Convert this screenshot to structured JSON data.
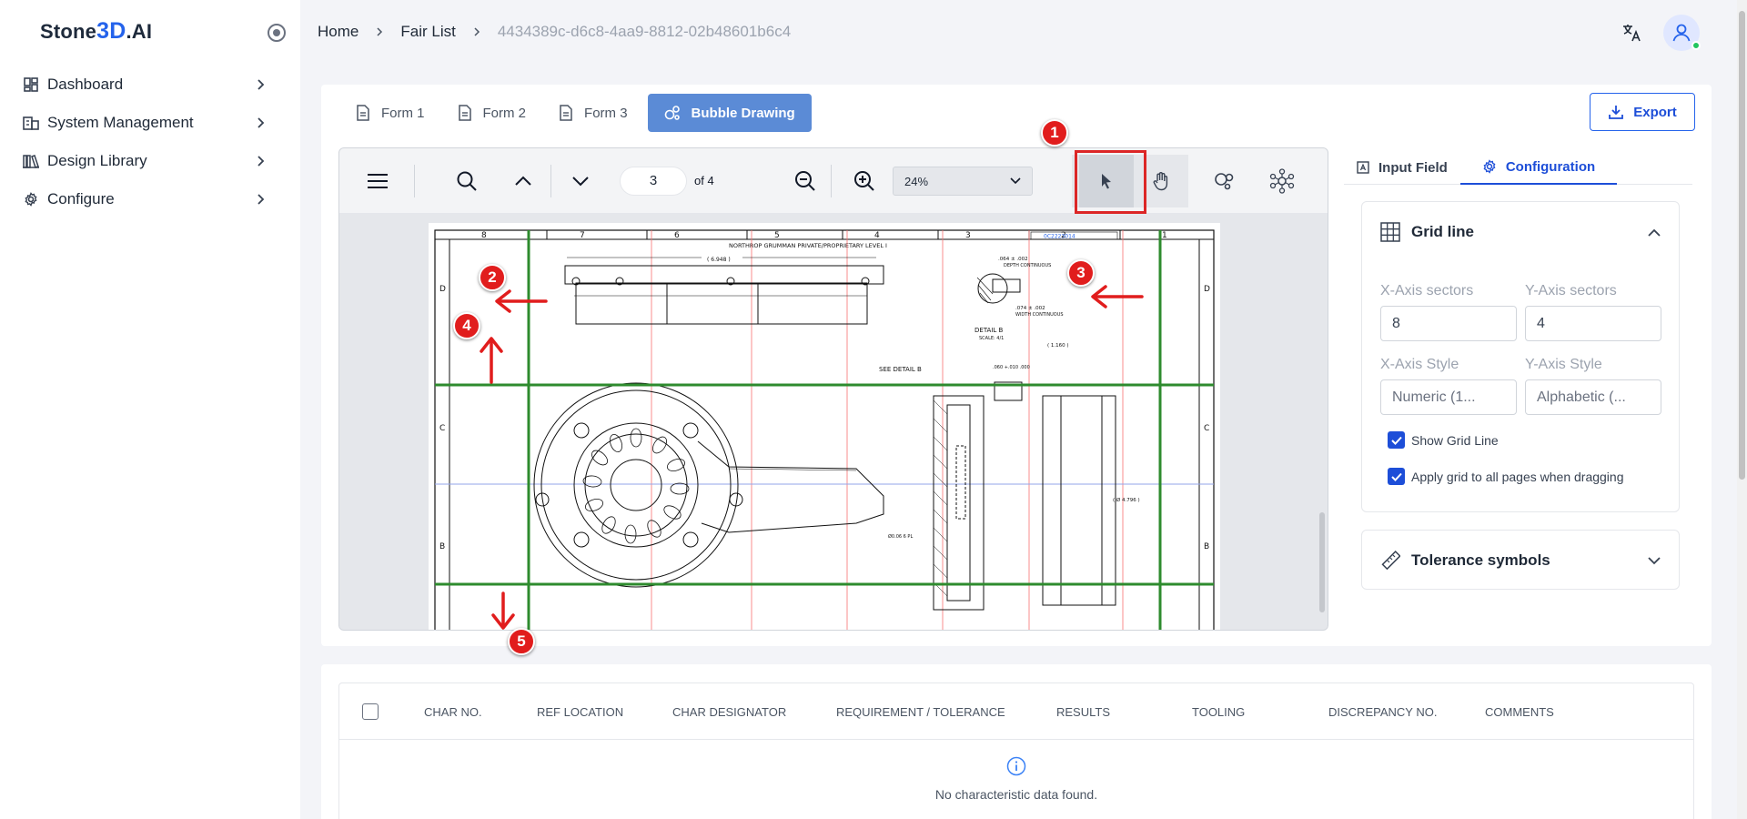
{
  "app": {
    "logo_prefix": "Stone",
    "logo_accent": "3D",
    "logo_suffix": ".AI"
  },
  "sidebar": {
    "items": [
      {
        "label": "Dashboard",
        "icon": "dashboard-icon"
      },
      {
        "label": "System Management",
        "icon": "building-icon"
      },
      {
        "label": "Design Library",
        "icon": "library-icon"
      },
      {
        "label": "Configure",
        "icon": "gear-icon"
      }
    ]
  },
  "breadcrumb": {
    "items": [
      "Home",
      "Fair List"
    ],
    "current": "4434389c-d6c8-4aa9-8812-02b48601b6c4"
  },
  "tabs": [
    {
      "label": "Form 1",
      "active": false
    },
    {
      "label": "Form 2",
      "active": false
    },
    {
      "label": "Form 3",
      "active": false
    },
    {
      "label": "Bubble Drawing",
      "active": true
    }
  ],
  "export_label": "Export",
  "viewer": {
    "page_current": "3",
    "page_total_label": "of 4",
    "zoom": "24%",
    "selected_tool": "select-pointer"
  },
  "drawing": {
    "header_text": "NORTHROP GRUMMAN PRIVATE/PROPRIETARY LEVEL I",
    "drawing_number": "0C2223014",
    "detail_label": "DETAIL B",
    "scale_label": "SCALE: 4/1",
    "see_detail": "SEE DETAIL B",
    "col_labels": [
      "8",
      "7",
      "6",
      "5",
      "4",
      "3",
      "2",
      "1"
    ],
    "row_labels": [
      "D",
      "C",
      "B"
    ],
    "dims": [
      "( 6.948 )",
      ".064 ± .002",
      "DEPTH CONTINUOUS",
      ".074 ± .002",
      "WIDTH CONTINUOUS",
      "( 1.160 )",
      ".060 +.010 .000",
      "( Ø 4.796 )",
      "Ø0.06 6 PL"
    ]
  },
  "annotations": [
    {
      "number": "1"
    },
    {
      "number": "2"
    },
    {
      "number": "3"
    },
    {
      "number": "4"
    },
    {
      "number": "5"
    }
  ],
  "right_panel": {
    "tabs": [
      {
        "label": "Input Field",
        "active": false
      },
      {
        "label": "Configuration",
        "active": true
      }
    ],
    "grid_line": {
      "title": "Grid line",
      "x_sectors_label": "X-Axis sectors",
      "y_sectors_label": "Y-Axis sectors",
      "x_sectors_value": "8",
      "y_sectors_value": "4",
      "x_style_label": "X-Axis Style",
      "y_style_label": "Y-Axis Style",
      "x_style_value": "Numeric (1...",
      "y_style_value": "Alphabetic (...",
      "show_grid_label": "Show Grid Line",
      "show_grid_checked": true,
      "apply_all_label": "Apply grid to all pages when dragging",
      "apply_all_checked": true
    },
    "tolerance": {
      "title": "Tolerance symbols"
    }
  },
  "table": {
    "columns": [
      "CHAR NO.",
      "REF LOCATION",
      "CHAR DESIGNATOR",
      "REQUIREMENT / TOLERANCE",
      "RESULTS",
      "TOOLING",
      "DISCREPANCY NO.",
      "COMMENTS"
    ],
    "empty_message": "No characteristic data found."
  },
  "colors": {
    "accent": "#1d4ed8",
    "active_tab": "#5b8bd6",
    "annotation_red": "#e11d1d",
    "grid_green": "#2e8b2e"
  }
}
